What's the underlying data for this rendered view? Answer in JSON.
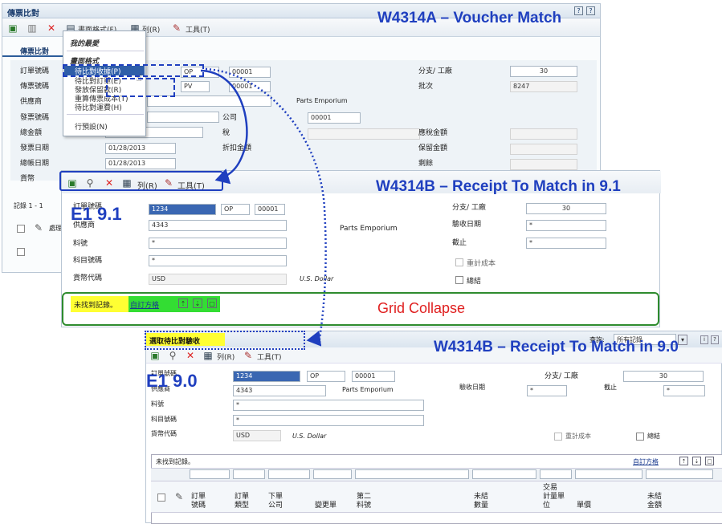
{
  "w1": {
    "heading": "W4314A – Voucher Match",
    "title": "傳票比對",
    "toolbar": {
      "form_label": "畫面格式(F)",
      "row_label": "列(R)",
      "tools_label": "工具(T)"
    },
    "form_tab": "傳票比對",
    "labels": {
      "order_no": "訂單號碼",
      "voucher_no": "傳票號碼",
      "supplier": "供應商",
      "invoice_no": "發票號碼",
      "total": "總金額",
      "invoice_date": "發票日期",
      "gl_date": "總帳日期",
      "currency": "貨幣",
      "branch": "分支/ 工廠",
      "batch": "批次",
      "company": "公司",
      "tax": "稅",
      "discount": "折扣金額",
      "taxable": "應稅金額",
      "retainage": "保留金額",
      "remaining": "剩餘"
    },
    "values": {
      "order_type": "OP",
      "order_co": "00001",
      "voucher_type": "PV",
      "voucher_co": "00001",
      "supplier_name": "Parts Emporium",
      "company": "00001",
      "branch": "30",
      "batch": "8247",
      "invoice_date": "01/28/2013",
      "gl_date": "01/28/2013"
    },
    "records": "記錄 1 - 1",
    "grid_col": "處理"
  },
  "menu": {
    "favorites": "我的最愛",
    "section": "畫面格式",
    "items": [
      "待比對收據(P)",
      "待比對訂單(E)",
      "發放保留款(R)",
      "重算傳票成本(T)",
      "待比對運費(H)"
    ],
    "preferences": "行預設(N)"
  },
  "w2": {
    "heading": "W4314B – Receipt To Match in 9.1",
    "version": "E1 9.1",
    "toolbar": {
      "row_label": "列(R)",
      "tools_label": "工具(T)"
    },
    "labels": {
      "order_no": "訂單號碼",
      "supplier": "供應商",
      "item": "料號",
      "account": "科目號碼",
      "currency": "貨幣代碼",
      "branch": "分支/ 工廠",
      "receipt_date": "驗收日期",
      "cutoff": "截止",
      "recost": "重計成本",
      "closed": "總結"
    },
    "values": {
      "order_no": "1234",
      "order_type": "OP",
      "order_co": "00001",
      "supplier": "4343",
      "supplier_name": "Parts Emporium",
      "item": "*",
      "account": "*",
      "currency": "USD",
      "currency_name": "U.S. Dollar",
      "branch": "30",
      "receipt_date": "*",
      "cutoff": "*"
    },
    "grid_msg": "未找到記錄。",
    "custom_grid": "自訂方格",
    "grid_collapse": "Grid Collapse"
  },
  "w3": {
    "heading": "W4314B – Receipt To Match in 9.0",
    "version": "E1 9.0",
    "title": "選取待比對驗收",
    "query_label": "查詢:",
    "query_value": "所有記錄",
    "toolbar": {
      "row_label": "列(R)",
      "tools_label": "工具(T)"
    },
    "labels": {
      "order_no": "訂單號碼",
      "supplier": "供應商",
      "item": "料號",
      "account": "科目號碼",
      "currency": "貨幣代碼",
      "branch": "分支/ 工廠",
      "receipt_date": "驗收日期",
      "cutoff": "截止",
      "recost": "重計成本",
      "closed": "總結"
    },
    "values": {
      "order_no": "1234",
      "order_type": "OP",
      "order_co": "00001",
      "supplier": "4343",
      "supplier_name": "Parts Emporium",
      "item": "*",
      "account": "*",
      "currency": "USD",
      "currency_name": "U.S. Dollar",
      "branch": "30",
      "receipt_date": "*",
      "cutoff": "*"
    },
    "grid_msg": "未找到記錄。",
    "custom_grid": "自訂方格",
    "columns": [
      "訂單\n號碼",
      "訂單\n類型",
      "下單\n公司",
      "變更單",
      "第二\n料號",
      "未結\n數量",
      "交易\n計量單\n位",
      "單價",
      "未結\n金額"
    ]
  },
  "colors": {
    "accent_blue": "#1f3fbf",
    "highlight_yellow": "#ffff33",
    "highlight_green": "#33dd33",
    "collapse_red": "#e02020",
    "collapse_green": "#2e8b2e"
  }
}
